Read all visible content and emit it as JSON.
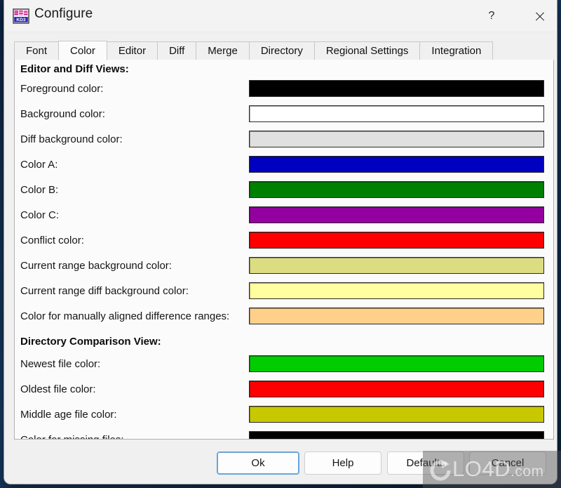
{
  "window": {
    "title": "Configure",
    "icon": "kdiff3-app-icon",
    "help_glyph": "?",
    "close_glyph": "✕"
  },
  "tabs": [
    {
      "label": "Font",
      "selected": false
    },
    {
      "label": "Color",
      "selected": true
    },
    {
      "label": "Editor",
      "selected": false
    },
    {
      "label": "Diff",
      "selected": false
    },
    {
      "label": "Merge",
      "selected": false
    },
    {
      "label": "Directory",
      "selected": false
    },
    {
      "label": "Regional Settings",
      "selected": false
    },
    {
      "label": "Integration",
      "selected": false
    }
  ],
  "sections": [
    {
      "heading": "Editor and Diff Views:"
    },
    {
      "heading": "Directory Comparison View:"
    }
  ],
  "settings": [
    {
      "label": "Foreground color:",
      "color": "#000000"
    },
    {
      "label": "Background color:",
      "color": "#ffffff"
    },
    {
      "label": "Diff background color:",
      "color": "#e0e0e0"
    },
    {
      "label": "Color A:",
      "color": "#0000c0"
    },
    {
      "label": "Color B:",
      "color": "#008000"
    },
    {
      "label": "Color C:",
      "color": "#9400a0"
    },
    {
      "label": "Conflict color:",
      "color": "#ff0000"
    },
    {
      "label": "Current range background color:",
      "color": "#dcdc82"
    },
    {
      "label": "Current range diff background color:",
      "color": "#ffffa0"
    },
    {
      "label": "Color for manually aligned difference ranges:",
      "color": "#ffd08a"
    },
    {
      "label": "Newest file color:",
      "color": "#00cc00"
    },
    {
      "label": "Oldest file color:",
      "color": "#ff0000"
    },
    {
      "label": "Middle age file color:",
      "color": "#c8c800"
    },
    {
      "label": "Color for missing files:",
      "color": "#000000"
    }
  ],
  "buttons": {
    "ok": "Ok",
    "help": "Help",
    "defaults": "Defaults",
    "cancel": "Cancel"
  },
  "watermark": {
    "text": "LO4D",
    "suffix": ".com",
    "logo": "circular-arrow-icon"
  }
}
